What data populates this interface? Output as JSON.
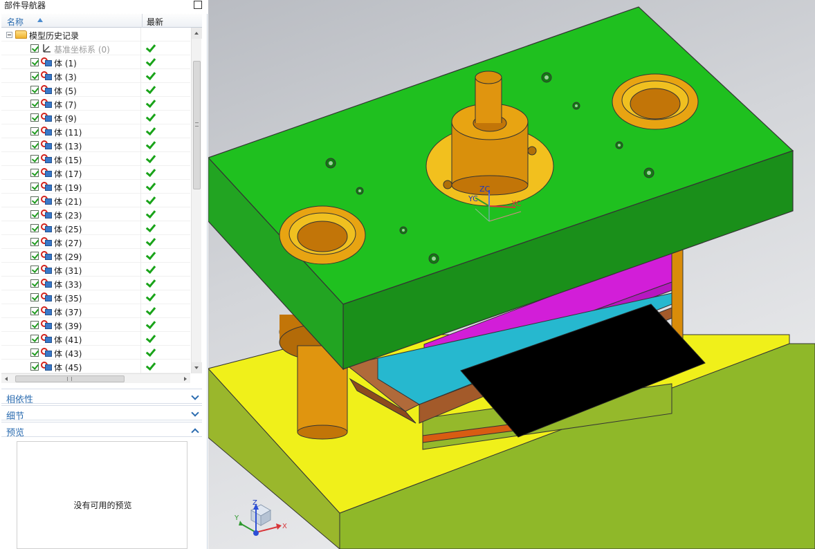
{
  "navigator": {
    "title": "部件导航器",
    "columns": {
      "name": "名称",
      "latest": "最新"
    },
    "root": "模型历史记录",
    "datum": "基准坐标系 (0)",
    "items": [
      "体 (1)",
      "体 (3)",
      "体 (5)",
      "体 (7)",
      "体 (9)",
      "体 (11)",
      "体 (13)",
      "体 (15)",
      "体 (17)",
      "体 (19)",
      "体 (21)",
      "体 (23)",
      "体 (25)",
      "体 (27)",
      "体 (29)",
      "体 (31)",
      "体 (33)",
      "体 (35)",
      "体 (37)",
      "体 (39)",
      "体 (41)",
      "体 (43)",
      "体 (45)"
    ]
  },
  "sections": {
    "dependencies": "相依性",
    "details": "细节",
    "preview": "预览"
  },
  "preview_empty": "没有可用的预览",
  "viewport": {
    "wcs_labels": {
      "z": "ZC",
      "y": "YC",
      "x": "XC"
    },
    "triad_labels": {
      "z": "Z",
      "y": "Y",
      "x": "X"
    }
  },
  "colors": {
    "top_plate": "#1fbd1f",
    "base_plate": "#f2f219",
    "guide_post": "#d98c0a",
    "punch_holder": "#b81cc8",
    "stripper": "#28b4c8",
    "strip": "#000000",
    "accent": "#2b6cb0"
  }
}
